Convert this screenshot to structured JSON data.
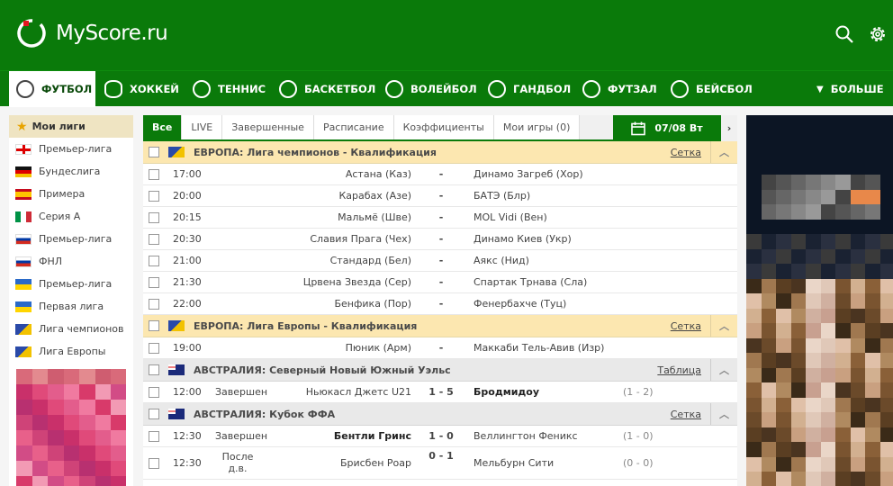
{
  "brand": {
    "name": "MyScore.ru",
    "colors": {
      "green": "#0a7a0a",
      "orange_banner": "#fce7b0"
    }
  },
  "header": {
    "icons": [
      "search-icon",
      "gear-icon"
    ]
  },
  "sports": [
    {
      "label": "ФУТБОЛ",
      "icon": "soccer-ball-icon",
      "active": true
    },
    {
      "label": "ХОККЕЙ",
      "icon": "hockey-puck-icon"
    },
    {
      "label": "ТЕННИС",
      "icon": "tennis-ball-icon"
    },
    {
      "label": "БАСКЕТБОЛ",
      "icon": "basketball-icon"
    },
    {
      "label": "ВОЛЕЙБОЛ",
      "icon": "volleyball-icon"
    },
    {
      "label": "ГАНДБОЛ",
      "icon": "handball-icon"
    },
    {
      "label": "ФУТЗАЛ",
      "icon": "futsal-ball-icon"
    },
    {
      "label": "БЕЙСБОЛ",
      "icon": "baseball-icon"
    },
    {
      "label": "БОЛЬШЕ",
      "icon": "caret-down-icon"
    }
  ],
  "sidebar": {
    "title": "Мои лиги",
    "leagues": [
      {
        "label": "Премьер-лига",
        "flag": "england"
      },
      {
        "label": "Бундеслига",
        "flag": "germany"
      },
      {
        "label": "Примера",
        "flag": "spain"
      },
      {
        "label": "Серия А",
        "flag": "italy"
      },
      {
        "label": "Премьер-лига",
        "flag": "russia"
      },
      {
        "label": "ФНЛ",
        "flag": "russia"
      },
      {
        "label": "Премьер-лига",
        "flag": "ukraine"
      },
      {
        "label": "Первая лига",
        "flag": "ukraine"
      },
      {
        "label": "Лига чемпионов",
        "flag": "europe"
      },
      {
        "label": "Лига Европы",
        "flag": "europe"
      }
    ]
  },
  "tabs": [
    "Все",
    "LIVE",
    "Завершенные",
    "Расписание",
    "Коэффициенты",
    "Мои игры (0)"
  ],
  "date": "07/08 Вт",
  "groups": [
    {
      "title": "ЕВРОПА: Лига чемпионов - Квалификация",
      "link": "Сетка",
      "flag": "europe",
      "style": "eu",
      "matches": [
        {
          "time": "17:00",
          "status": "",
          "home": "Астана (Каз)",
          "score": "-",
          "away": "Динамо Загреб (Хор)",
          "half": ""
        },
        {
          "time": "20:00",
          "status": "",
          "home": "Карабах (Азе)",
          "score": "-",
          "away": "БАТЭ (Блр)",
          "half": ""
        },
        {
          "time": "20:15",
          "status": "",
          "home": "Мальмё (Шве)",
          "score": "-",
          "away": "MOL Vidi (Вен)",
          "half": ""
        },
        {
          "time": "20:30",
          "status": "",
          "home": "Славия Прага (Чех)",
          "score": "-",
          "away": "Динамо Киев (Укр)",
          "half": ""
        },
        {
          "time": "21:00",
          "status": "",
          "home": "Стандард (Бел)",
          "score": "-",
          "away": "Аякс (Нид)",
          "half": ""
        },
        {
          "time": "21:30",
          "status": "",
          "home": "Црвена Звезда (Сер)",
          "score": "-",
          "away": "Спартак Трнава (Сла)",
          "half": ""
        },
        {
          "time": "22:00",
          "status": "",
          "home": "Бенфика (Пор)",
          "score": "-",
          "away": "Фенербахче (Туц)",
          "half": ""
        }
      ]
    },
    {
      "title": "ЕВРОПА: Лига Европы - Квалификация",
      "link": "Сетка",
      "flag": "europe",
      "style": "eu",
      "matches": [
        {
          "time": "19:00",
          "status": "",
          "home": "Пюник (Арм)",
          "score": "-",
          "away": "Маккаби Тель-Авив (Изр)",
          "half": ""
        }
      ]
    },
    {
      "title": "АВСТРАЛИЯ: Северный Новый Южный Уэльс",
      "link": "Таблица",
      "flag": "australia",
      "style": "au",
      "matches": [
        {
          "time": "12:00",
          "status": "Завершен",
          "home": "Ньюкасл Джетс U21",
          "score": "1 - 5",
          "away": "Бродмидоу",
          "half": "(1 - 2)",
          "winner": "away"
        }
      ]
    },
    {
      "title": "АВСТРАЛИЯ: Кубок ФФА",
      "link": "Сетка",
      "flag": "australia",
      "style": "au",
      "matches": [
        {
          "time": "12:30",
          "status": "Завершен",
          "home": "Бентли Гринс",
          "score": "1 - 0",
          "away": "Веллингтон Феникс",
          "half": "(1 - 0)",
          "winner": "home"
        },
        {
          "time": "12:30",
          "status": "После д.в.",
          "home": "Брисбен Роар",
          "score": "0 - 1",
          "away": "Мельбурн Сити",
          "half": "(0 - 0)",
          "tall": true
        }
      ]
    }
  ]
}
